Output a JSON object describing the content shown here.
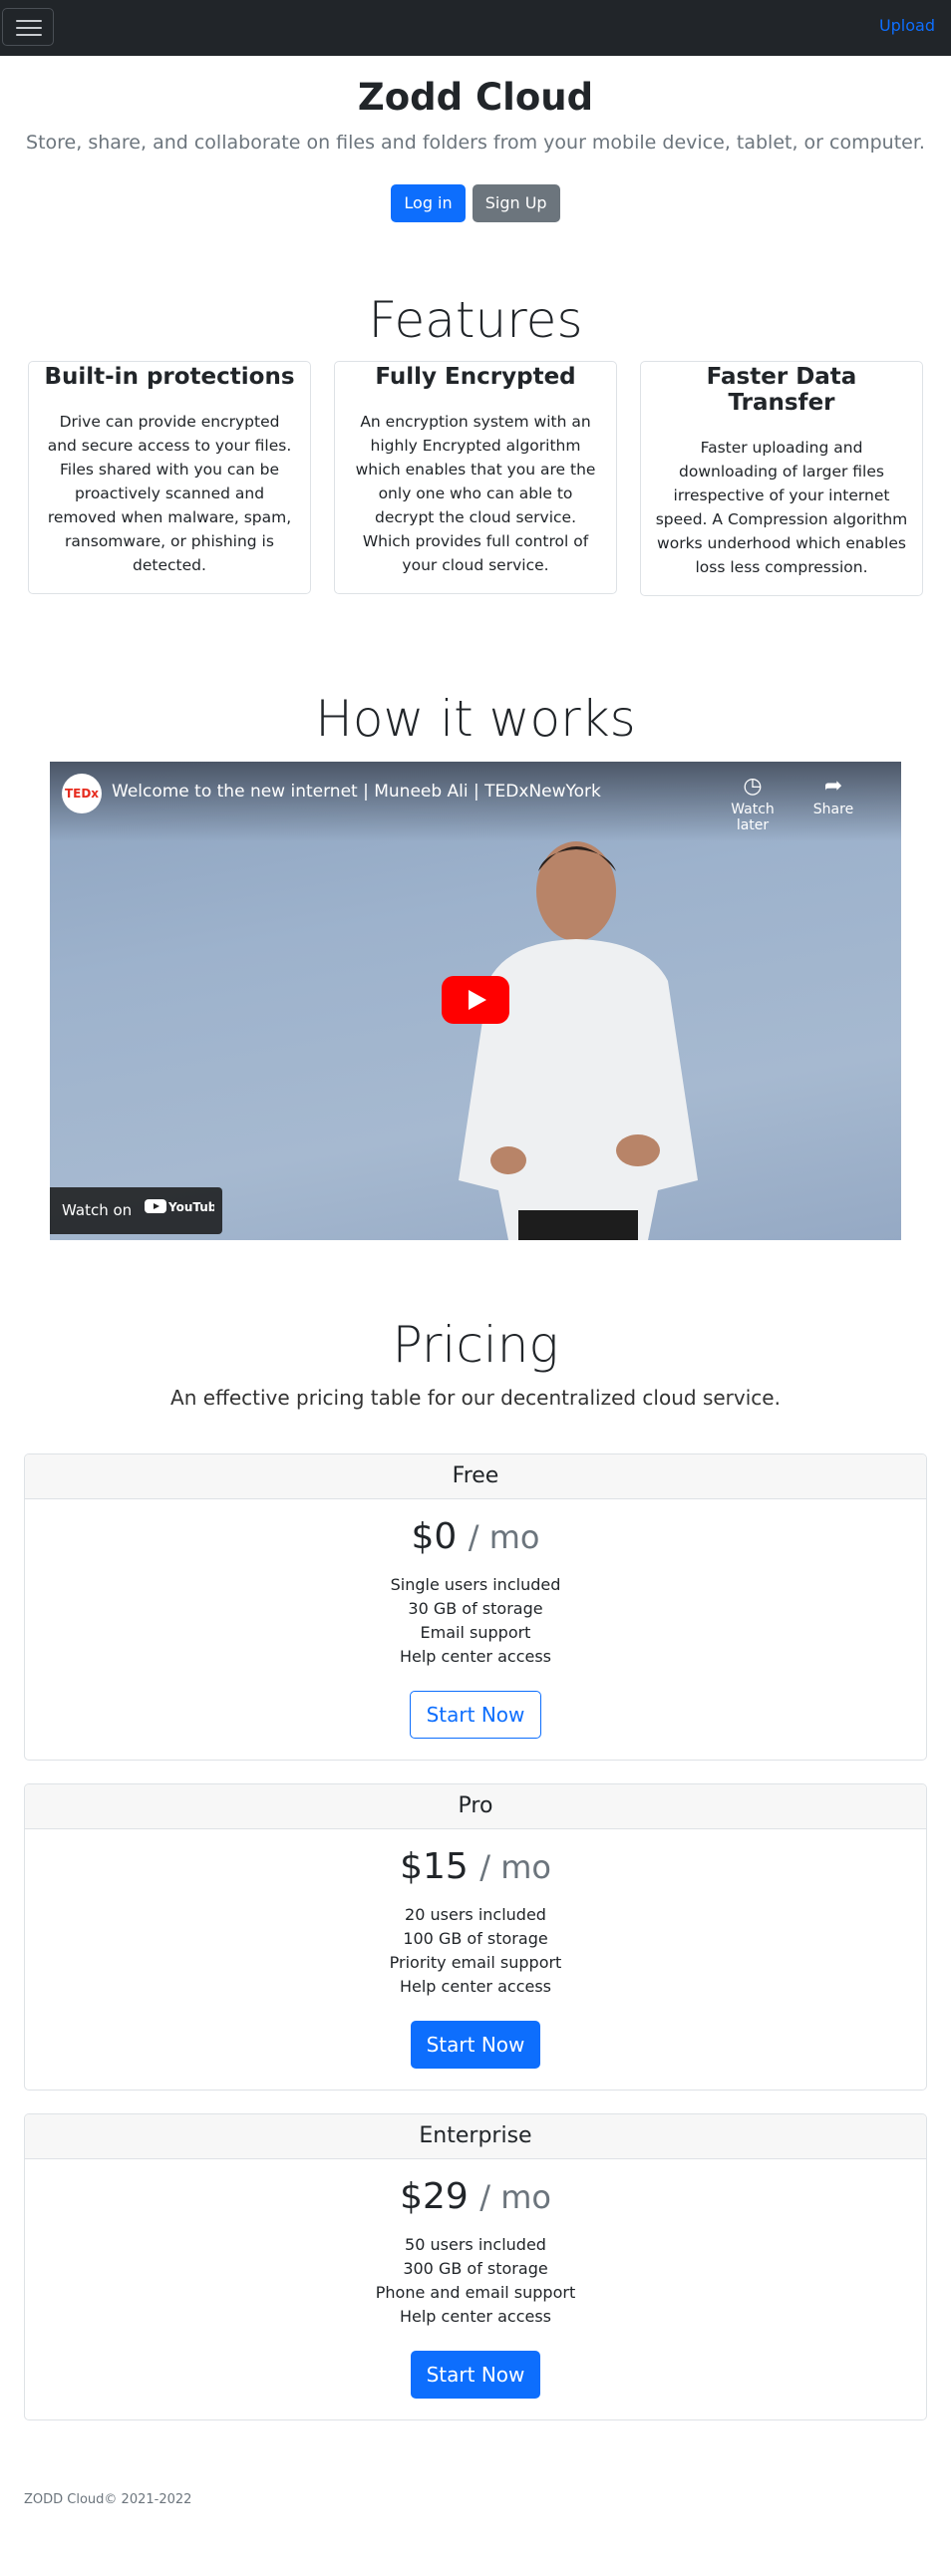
{
  "navbar": {
    "toggle_icon": "hamburger-icon",
    "upload_label": "Upload"
  },
  "hero": {
    "title": "Zodd Cloud",
    "subtitle": "Store, share, and collaborate on files and folders from your mobile device, tablet, or computer.",
    "login_label": "Log in",
    "signup_label": "Sign Up"
  },
  "features": {
    "title": "Features",
    "items": [
      {
        "title": "Built-in protections",
        "text": "Drive can provide encrypted and secure access to your files. Files shared with you can be proactively scanned and removed when malware, spam, ransomware, or phishing is detected."
      },
      {
        "title": "Fully Encrypted",
        "text": "An encryption system with an highly Encrypted algorithm which enables that you are the only one who can able to decrypt the cloud service. Which provides full control of your cloud service."
      },
      {
        "title": "Faster Data Transfer",
        "text": "Faster uploading and downloading of larger files irrespective of your internet speed. A Compression algorithm works underhood which enables loss less compression."
      }
    ]
  },
  "how_it_works": {
    "title": "How it works",
    "video": {
      "channel_logo": "TEDx",
      "title": "Welcome to the new internet | Muneeb Ali | TEDxNewYork",
      "watch_later": "Watch later",
      "share": "Share",
      "watch_on": "Watch on",
      "youtube": "YouTube"
    }
  },
  "pricing": {
    "title": "Pricing",
    "subtitle": "An effective pricing table for our decentralized cloud service.",
    "per": "/ mo",
    "plans": [
      {
        "name": "Free",
        "price": "$0",
        "features": [
          "Single users included",
          "30 GB of storage",
          "Email support",
          "Help center access"
        ],
        "button": "Start Now"
      },
      {
        "name": "Pro",
        "price": "$15",
        "features": [
          "20 users included",
          "100 GB of storage",
          "Priority email support",
          "Help center access"
        ],
        "button": "Start Now"
      },
      {
        "name": "Enterprise",
        "price": "$29",
        "features": [
          "50 users included",
          "300 GB of storage",
          "Phone and email support",
          "Help center access"
        ],
        "button": "Start Now"
      }
    ]
  },
  "footer": {
    "text": "ZODD Cloud© 2021-2022"
  },
  "colors": {
    "primary": "#0d6efd",
    "secondary": "#6c757d",
    "navbar": "#212529"
  }
}
